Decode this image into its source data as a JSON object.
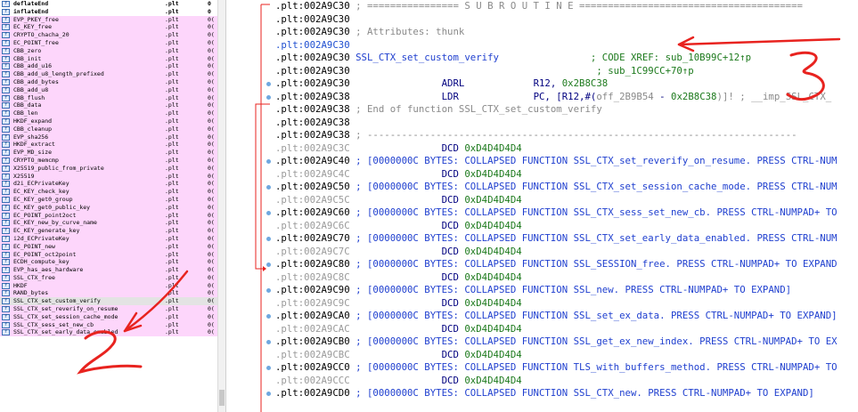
{
  "functions": [
    {
      "name": "deflateEnd",
      "seg": ".plt",
      "start": "0",
      "bold": true
    },
    {
      "name": "inflateEnd",
      "seg": ".plt",
      "start": "0",
      "bold": true
    },
    {
      "name": "EVP_PKEY_free",
      "seg": ".plt",
      "start": "0("
    },
    {
      "name": "EC_KEY_free",
      "seg": ".plt",
      "start": "0("
    },
    {
      "name": "CRYPTO_chacha_20",
      "seg": ".plt",
      "start": "0("
    },
    {
      "name": "EC_POINT_free",
      "seg": ".plt",
      "start": "0("
    },
    {
      "name": "CBB_zero",
      "seg": ".plt",
      "start": "0("
    },
    {
      "name": "CBB_init",
      "seg": ".plt",
      "start": "0("
    },
    {
      "name": "CBB_add_u16",
      "seg": ".plt",
      "start": "0("
    },
    {
      "name": "CBB_add_u8_length_prefixed",
      "seg": ".plt",
      "start": "0("
    },
    {
      "name": "CBB_add_bytes",
      "seg": ".plt",
      "start": "0("
    },
    {
      "name": "CBB_add_u8",
      "seg": ".plt",
      "start": "0("
    },
    {
      "name": "CBB_flush",
      "seg": ".plt",
      "start": "0("
    },
    {
      "name": "CBB_data",
      "seg": ".plt",
      "start": "0("
    },
    {
      "name": "CBB_len",
      "seg": ".plt",
      "start": "0("
    },
    {
      "name": "HKDF_expand",
      "seg": ".plt",
      "start": "0("
    },
    {
      "name": "CBB_cleanup",
      "seg": ".plt",
      "start": "0("
    },
    {
      "name": "EVP_sha256",
      "seg": ".plt",
      "start": "0("
    },
    {
      "name": "HKDF_extract",
      "seg": ".plt",
      "start": "0("
    },
    {
      "name": "EVP_MD_size",
      "seg": ".plt",
      "start": "0("
    },
    {
      "name": "CRYPTO_memcmp",
      "seg": ".plt",
      "start": "0("
    },
    {
      "name": "X25519_public_from_private",
      "seg": ".plt",
      "start": "0("
    },
    {
      "name": "X25519",
      "seg": ".plt",
      "start": "0("
    },
    {
      "name": "d2i_ECPrivateKey",
      "seg": ".plt",
      "start": "0("
    },
    {
      "name": "EC_KEY_check_key",
      "seg": ".plt",
      "start": "0("
    },
    {
      "name": "EC_KEY_get0_group",
      "seg": ".plt",
      "start": "0("
    },
    {
      "name": "EC_KEY_get0_public_key",
      "seg": ".plt",
      "start": "0("
    },
    {
      "name": "EC_POINT_point2oct",
      "seg": ".plt",
      "start": "0("
    },
    {
      "name": "EC_KEY_new_by_curve_name",
      "seg": ".plt",
      "start": "0("
    },
    {
      "name": "EC_KEY_generate_key",
      "seg": ".plt",
      "start": "0("
    },
    {
      "name": "i2d_ECPrivateKey",
      "seg": ".plt",
      "start": "0("
    },
    {
      "name": "EC_POINT_new",
      "seg": ".plt",
      "start": "0("
    },
    {
      "name": "EC_POINT_oct2point",
      "seg": ".plt",
      "start": "0("
    },
    {
      "name": "ECDH_compute_key",
      "seg": ".plt",
      "start": "0("
    },
    {
      "name": "EVP_has_aes_hardware",
      "seg": ".plt",
      "start": "0("
    },
    {
      "name": "SSL_CTX_free",
      "seg": ".plt",
      "start": "0("
    },
    {
      "name": "HKDF",
      "seg": ".plt",
      "start": "0("
    },
    {
      "name": "RAND_bytes",
      "seg": ".plt",
      "start": "0("
    },
    {
      "name": "SSL_CTX_set_custom_verify",
      "seg": ".plt",
      "start": "0(",
      "selected": true
    },
    {
      "name": "SSL_CTX_set_reverify_on_resume",
      "seg": ".plt",
      "start": "0("
    },
    {
      "name": "SSL_CTX_set_session_cache_mode",
      "seg": ".plt",
      "start": "0("
    },
    {
      "name": "SSL_CTX_sess_set_new_cb",
      "seg": ".plt",
      "start": "0("
    },
    {
      "name": "SSL_CTX_set_early_data_enabled",
      "seg": ".plt",
      "start": "0("
    }
  ],
  "disasm": [
    {
      "addr": ".plt:002A9C30",
      "dim": false,
      "hl": false,
      "parts": [
        {
          "t": " ; ================ S U B R O U T I N E =======================================",
          "c": "c-gray"
        }
      ]
    },
    {
      "addr": ".plt:002A9C30",
      "dim": false,
      "hl": false,
      "parts": []
    },
    {
      "addr": ".plt:002A9C30",
      "dim": false,
      "hl": false,
      "parts": [
        {
          "t": " ; Attributes: thunk",
          "c": "c-gray"
        }
      ]
    },
    {
      "addr": ".plt:002A9C30",
      "dim": false,
      "hl": true,
      "parts": []
    },
    {
      "addr": ".plt:002A9C30",
      "dim": false,
      "hl": false,
      "parts": [
        {
          "t": " SSL_CTX_set_custom_verify",
          "c": "c-blue"
        },
        {
          "t": "                ; CODE XREF: ",
          "c": "c-green"
        },
        {
          "t": "sub_10B99C+12↑p",
          "c": "c-green"
        }
      ]
    },
    {
      "addr": ".plt:002A9C30",
      "dim": false,
      "hl": false,
      "parts": [
        {
          "t": "                                           ; ",
          "c": "c-green"
        },
        {
          "t": "sub_1C99CC+70↑p",
          "c": "c-green"
        }
      ]
    },
    {
      "addr": ".plt:002A9C30",
      "dim": false,
      "hl": false,
      "parts": [
        {
          "t": "                ADRL            ",
          "c": "c-navy"
        },
        {
          "t": "R12, ",
          "c": "c-navy"
        },
        {
          "t": "0x2B8C38",
          "c": "c-green"
        }
      ]
    },
    {
      "addr": ".plt:002A9C38",
      "dim": false,
      "hl": false,
      "parts": [
        {
          "t": "                LDR             ",
          "c": "c-navy"
        },
        {
          "t": "PC, [R12,#(",
          "c": "c-navy"
        },
        {
          "t": "off_2B9B54",
          "c": "c-gray"
        },
        {
          "t": " - ",
          "c": "c-navy"
        },
        {
          "t": "0x2B8C38",
          "c": "c-green"
        },
        {
          "t": ")]! ; __imp_SSL_CTX_",
          "c": "c-gray"
        }
      ]
    },
    {
      "addr": ".plt:002A9C38",
      "dim": false,
      "hl": false,
      "parts": [
        {
          "t": " ; End of function SSL_CTX_set_custom_verify",
          "c": "c-gray"
        }
      ]
    },
    {
      "addr": ".plt:002A9C38",
      "dim": false,
      "hl": false,
      "parts": []
    },
    {
      "addr": ".plt:002A9C38",
      "dim": false,
      "hl": false,
      "parts": [
        {
          "t": " ; ---------------------------------------------------------------------------",
          "c": "c-gray"
        }
      ]
    },
    {
      "addr": ".plt:002A9C3C",
      "dim": true,
      "hl": false,
      "parts": [
        {
          "t": "                DCD ",
          "c": "c-navy"
        },
        {
          "t": "0xD4D4D4D4",
          "c": "c-green"
        }
      ]
    },
    {
      "addr": ".plt:002A9C40",
      "dim": false,
      "hl": false,
      "parts": [
        {
          "t": " ; [0000000C BYTES: COLLAPSED FUNCTION SSL_CTX_set_reverify_on_resume. PRESS CTRL-NUM",
          "c": "c-blue"
        }
      ]
    },
    {
      "addr": ".plt:002A9C4C",
      "dim": true,
      "hl": false,
      "parts": [
        {
          "t": "                DCD ",
          "c": "c-navy"
        },
        {
          "t": "0xD4D4D4D4",
          "c": "c-green"
        }
      ]
    },
    {
      "addr": ".plt:002A9C50",
      "dim": false,
      "hl": false,
      "parts": [
        {
          "t": " ; [0000000C BYTES: COLLAPSED FUNCTION SSL_CTX_set_session_cache_mode. PRESS CTRL-NUM",
          "c": "c-blue"
        }
      ]
    },
    {
      "addr": ".plt:002A9C5C",
      "dim": true,
      "hl": false,
      "parts": [
        {
          "t": "                DCD ",
          "c": "c-navy"
        },
        {
          "t": "0xD4D4D4D4",
          "c": "c-green"
        }
      ]
    },
    {
      "addr": ".plt:002A9C60",
      "dim": false,
      "hl": false,
      "parts": [
        {
          "t": " ; [0000000C BYTES: COLLAPSED FUNCTION SSL_CTX_sess_set_new_cb. PRESS CTRL-NUMPAD+ TO",
          "c": "c-blue"
        }
      ]
    },
    {
      "addr": ".plt:002A9C6C",
      "dim": true,
      "hl": false,
      "parts": [
        {
          "t": "                DCD ",
          "c": "c-navy"
        },
        {
          "t": "0xD4D4D4D4",
          "c": "c-green"
        }
      ]
    },
    {
      "addr": ".plt:002A9C70",
      "dim": false,
      "hl": false,
      "parts": [
        {
          "t": " ; [0000000C BYTES: COLLAPSED FUNCTION SSL_CTX_set_early_data_enabled. PRESS CTRL-NUM",
          "c": "c-blue"
        }
      ]
    },
    {
      "addr": ".plt:002A9C7C",
      "dim": true,
      "hl": false,
      "parts": [
        {
          "t": "                DCD ",
          "c": "c-navy"
        },
        {
          "t": "0xD4D4D4D4",
          "c": "c-green"
        }
      ]
    },
    {
      "addr": ".plt:002A9C80",
      "dim": false,
      "hl": false,
      "parts": [
        {
          "t": " ; [0000000C BYTES: COLLAPSED FUNCTION SSL_SESSION_free. PRESS CTRL-NUMPAD+ TO EXPAND",
          "c": "c-blue"
        }
      ]
    },
    {
      "addr": ".plt:002A9C8C",
      "dim": true,
      "hl": false,
      "parts": [
        {
          "t": "                DCD ",
          "c": "c-navy"
        },
        {
          "t": "0xD4D4D4D4",
          "c": "c-green"
        }
      ]
    },
    {
      "addr": ".plt:002A9C90",
      "dim": false,
      "hl": false,
      "parts": [
        {
          "t": " ; [0000000C BYTES: COLLAPSED FUNCTION SSL_new. PRESS CTRL-NUMPAD+ TO EXPAND]",
          "c": "c-blue"
        }
      ]
    },
    {
      "addr": ".plt:002A9C9C",
      "dim": true,
      "hl": false,
      "parts": [
        {
          "t": "                DCD ",
          "c": "c-navy"
        },
        {
          "t": "0xD4D4D4D4",
          "c": "c-green"
        }
      ]
    },
    {
      "addr": ".plt:002A9CA0",
      "dim": false,
      "hl": false,
      "parts": [
        {
          "t": " ; [0000000C BYTES: COLLAPSED FUNCTION SSL_set_ex_data. PRESS CTRL-NUMPAD+ TO EXPAND]",
          "c": "c-blue"
        }
      ]
    },
    {
      "addr": ".plt:002A9CAC",
      "dim": true,
      "hl": false,
      "parts": [
        {
          "t": "                DCD ",
          "c": "c-navy"
        },
        {
          "t": "0xD4D4D4D4",
          "c": "c-green"
        }
      ]
    },
    {
      "addr": ".plt:002A9CB0",
      "dim": false,
      "hl": false,
      "parts": [
        {
          "t": " ; [0000000C BYTES: COLLAPSED FUNCTION SSL_get_ex_new_index. PRESS CTRL-NUMPAD+ TO EX",
          "c": "c-blue"
        }
      ]
    },
    {
      "addr": ".plt:002A9CBC",
      "dim": true,
      "hl": false,
      "parts": [
        {
          "t": "                DCD ",
          "c": "c-navy"
        },
        {
          "t": "0xD4D4D4D4",
          "c": "c-green"
        }
      ]
    },
    {
      "addr": ".plt:002A9CC0",
      "dim": false,
      "hl": false,
      "parts": [
        {
          "t": " ; [0000000C BYTES: COLLAPSED FUNCTION TLS_with_buffers_method. PRESS CTRL-NUMPAD+ TO",
          "c": "c-blue"
        }
      ]
    },
    {
      "addr": ".plt:002A9CCC",
      "dim": true,
      "hl": false,
      "parts": [
        {
          "t": "                DCD ",
          "c": "c-navy"
        },
        {
          "t": "0xD4D4D4D4",
          "c": "c-green"
        }
      ]
    },
    {
      "addr": ".plt:002A9CD0",
      "dim": false,
      "hl": false,
      "parts": [
        {
          "t": " ; [0000000C BYTES: COLLAPSED FUNCTION SSL_CTX_new. PRESS CTRL-NUMPAD+ TO EXPAND]",
          "c": "c-blue"
        }
      ]
    }
  ],
  "colors": {
    "thunk_bg": "#fdd6fb",
    "annotation_red": "#e8231f",
    "address_blue": "#1f4fd0"
  },
  "icons": {
    "function_icon": "function-f-icon",
    "flow_dot": "flow-dot-icon"
  }
}
